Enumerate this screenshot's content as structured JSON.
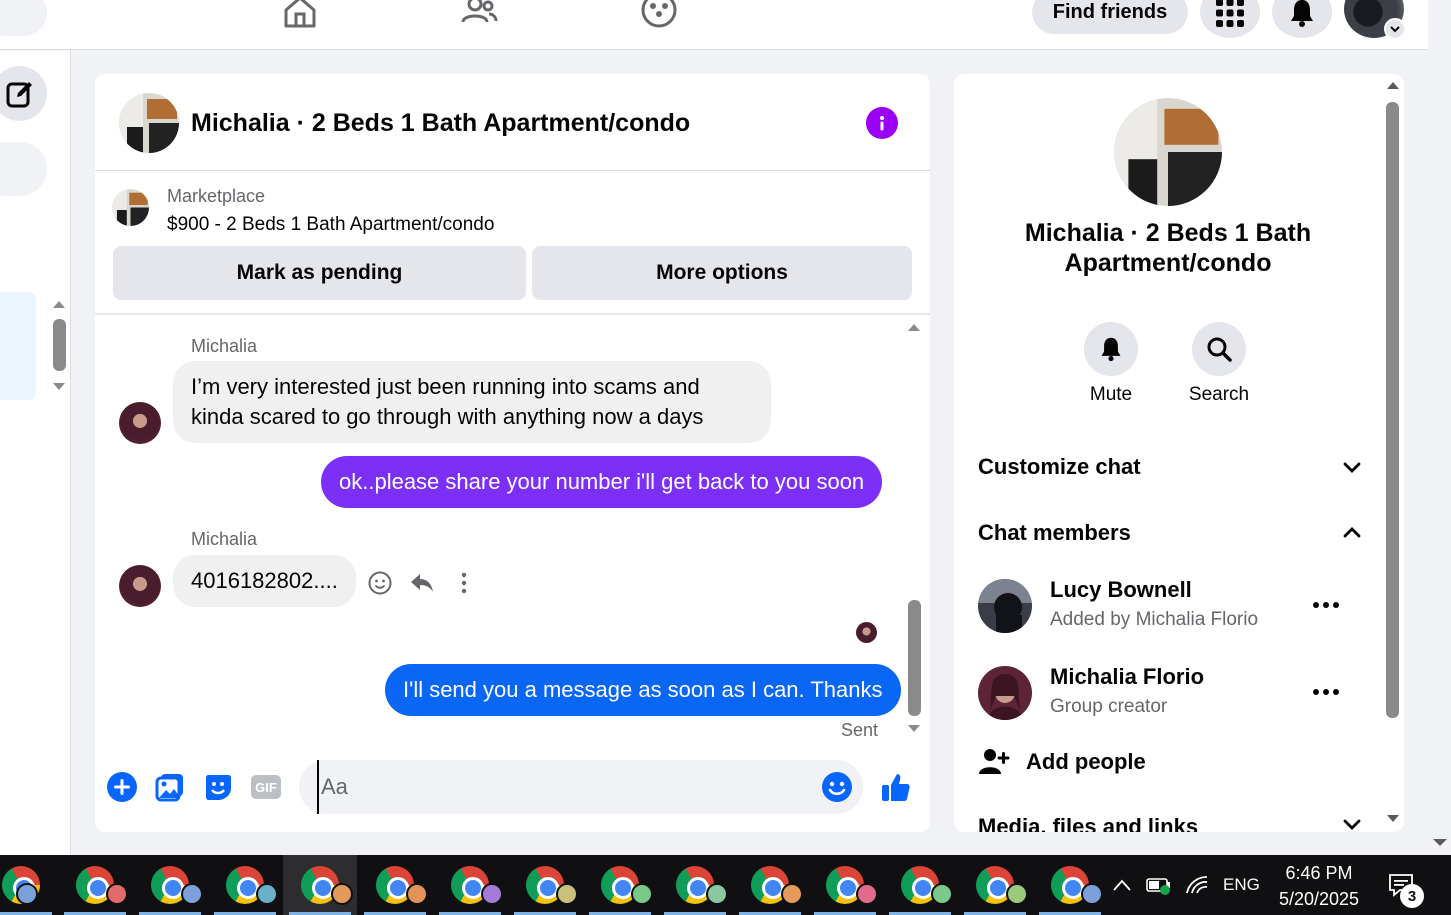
{
  "colors": {
    "messenger_purple": "#7b2ff7",
    "messenger_blue": "#0a66f5",
    "info_purple": "#9b00f5",
    "accent_blue": "#0866ff"
  },
  "topbar": {
    "find_friends_label": "Find friends",
    "nav_icons": [
      "home-icon",
      "friends-icon",
      "groups-icon"
    ],
    "right_icons": [
      "menu-grid-icon",
      "bell-icon",
      "account-avatar"
    ]
  },
  "chat": {
    "title": "Michalia · 2 Beds 1 Bath Apartment/condo",
    "marketplace": {
      "label": "Marketplace",
      "listing": "$900 - 2 Beds 1 Bath Apartment/condo",
      "mark_pending_label": "Mark as pending",
      "more_options_label": "More options"
    },
    "messages": [
      {
        "sender": "Michalia",
        "direction": "in",
        "text": "I’m very interested just been running into scams and kinda scared to go through with anything now a days"
      },
      {
        "direction": "out",
        "text": "ok..please share your number i'll get back to you soon"
      },
      {
        "sender": "Michalia",
        "direction": "in",
        "text": "4016182802...."
      },
      {
        "direction": "out",
        "text": "I'll send you a message as soon as I can. Thanks",
        "status": "Sent"
      }
    ],
    "composer": {
      "placeholder": "Aa",
      "icons": [
        "add-icon",
        "photo-icon",
        "sticker-icon",
        "gif-icon",
        "emoji-icon",
        "like-icon"
      ],
      "gif_label": "GIF"
    }
  },
  "info_panel": {
    "title": "Michalia · 2 Beds 1 Bath Apartment/condo",
    "actions": [
      {
        "label": "Mute",
        "icon": "bell-icon"
      },
      {
        "label": "Search",
        "icon": "search-icon"
      }
    ],
    "sections": {
      "customize": "Customize chat",
      "members": "Chat members",
      "media": "Media, files and links"
    },
    "members": [
      {
        "name": "Lucy Bownell",
        "subtitle": "Added by Michalia Florio"
      },
      {
        "name": "Michalia Florio",
        "subtitle": "Group creator"
      }
    ],
    "add_people_label": "Add people"
  },
  "taskbar": {
    "language": "ENG",
    "time": "6:46 PM",
    "date": "5/20/2025",
    "notification_count": "3",
    "app_count": 15
  }
}
